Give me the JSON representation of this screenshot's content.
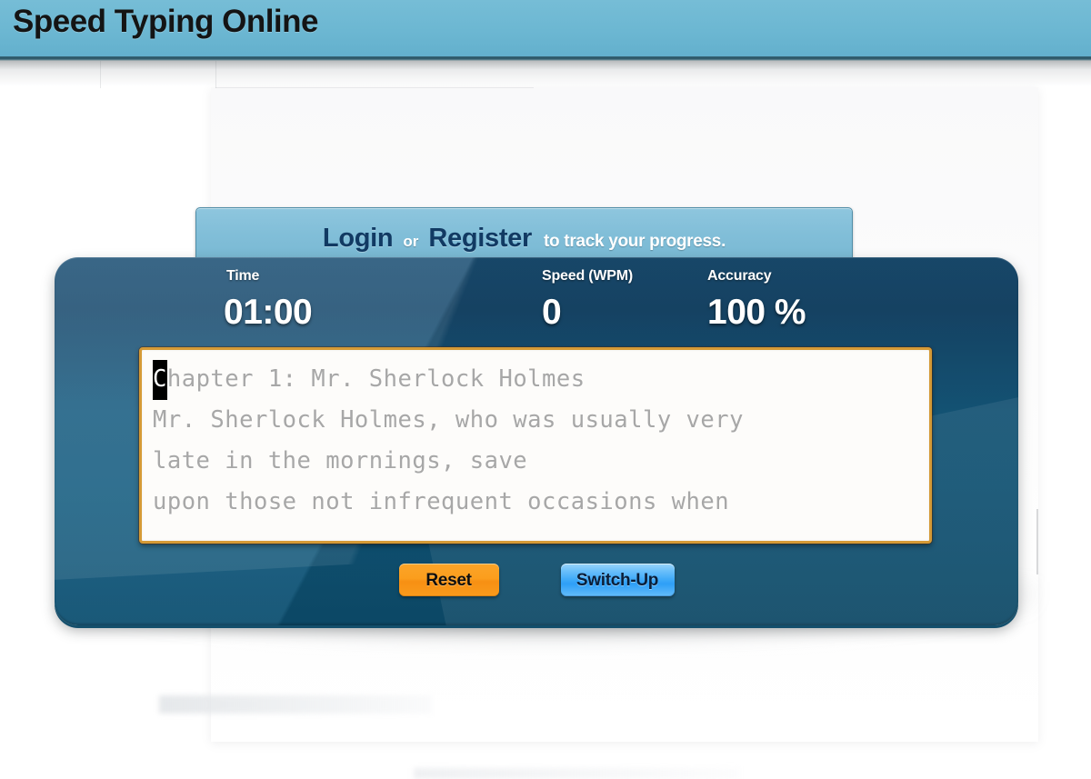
{
  "header": {
    "title": "Speed Typing Online",
    "background_color": "#6cb7d2"
  },
  "login_strip": {
    "login_label": "Login",
    "separator": "or",
    "register_label": "Register",
    "tail_text": "to track your progress.",
    "link_color": "#113a63",
    "background_color": "#81bed8"
  },
  "stats": {
    "time": {
      "label": "Time",
      "value": "01:00"
    },
    "speed": {
      "label": "Speed (WPM)",
      "value": "0"
    },
    "accuracy": {
      "label": "Accuracy",
      "value": "100 %"
    }
  },
  "typing_area": {
    "cursor_char": "C",
    "remaining_first_line": "hapter 1: Mr. Sherlock Holmes",
    "lines": [
      "Chapter 1: Mr. Sherlock Holmes",
      "Mr. Sherlock Holmes, who was usually very",
      "late in the mornings, save",
      "upon those not infrequent occasions when"
    ],
    "body_text": "Mr. Sherlock Holmes, who was usually very\nlate in the mornings, save\nupon those not infrequent occasions when",
    "border_color": "#d59a36",
    "text_color": "#a7a7a7",
    "background_color": "#fdfcfa"
  },
  "buttons": {
    "reset": {
      "label": "Reset",
      "color": "#fb9e1d"
    },
    "switch_up": {
      "label": "Switch-Up",
      "color": "#3aa7f8"
    }
  },
  "panel": {
    "background_color": "#115a7e"
  }
}
